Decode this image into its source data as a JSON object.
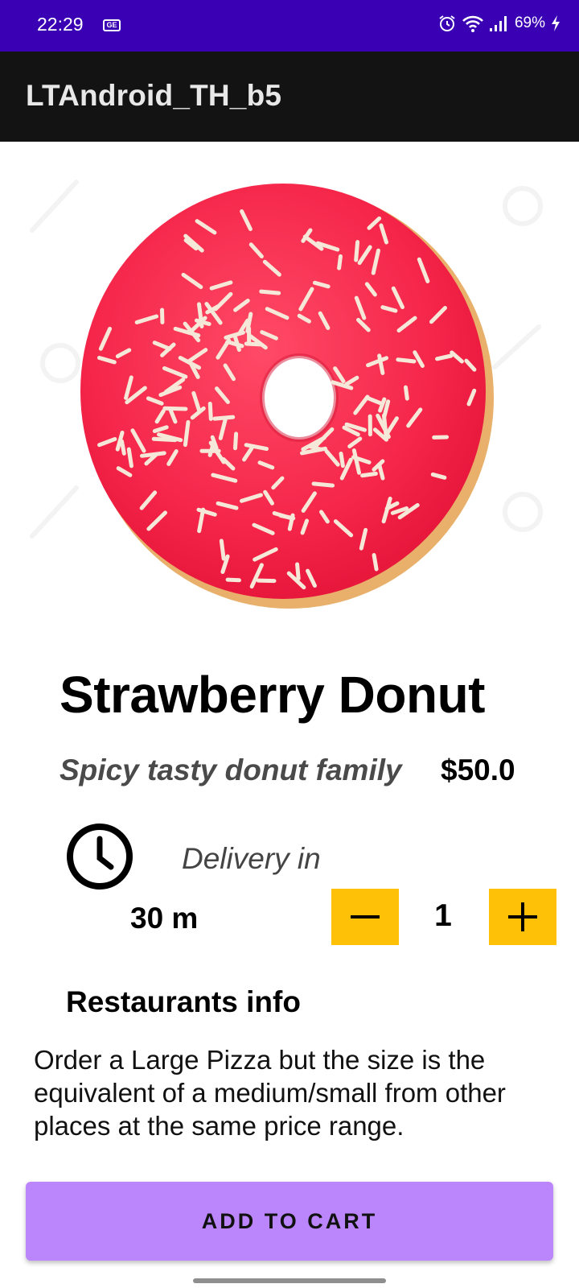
{
  "status_bar": {
    "time": "22:29",
    "sim_label": "GE",
    "battery": "69%",
    "icons": [
      "alarm-icon",
      "wifi-icon",
      "signal-icon",
      "charging-icon"
    ],
    "color": "#3a00b4"
  },
  "app_bar": {
    "title": "LTAndroid_TH_b5",
    "color": "#131313"
  },
  "product": {
    "image": "strawberry-donut-image",
    "name": "Strawberry Donut",
    "subtitle": "Spicy tasty donut family",
    "price": "$50.0"
  },
  "delivery": {
    "label": "Delivery in",
    "time": "30 m",
    "icon": "clock-icon"
  },
  "quantity": {
    "value": "1",
    "minus_icon": "minus-icon",
    "plus_icon": "plus-icon",
    "button_color": "#ffc107"
  },
  "restaurant": {
    "title": "Restaurants info",
    "description": " Order a Large Pizza but the size is the equivalent of a medium/small from other places at the same price range."
  },
  "cta": {
    "label": "ADD TO CART",
    "color": "#bb86fc"
  }
}
